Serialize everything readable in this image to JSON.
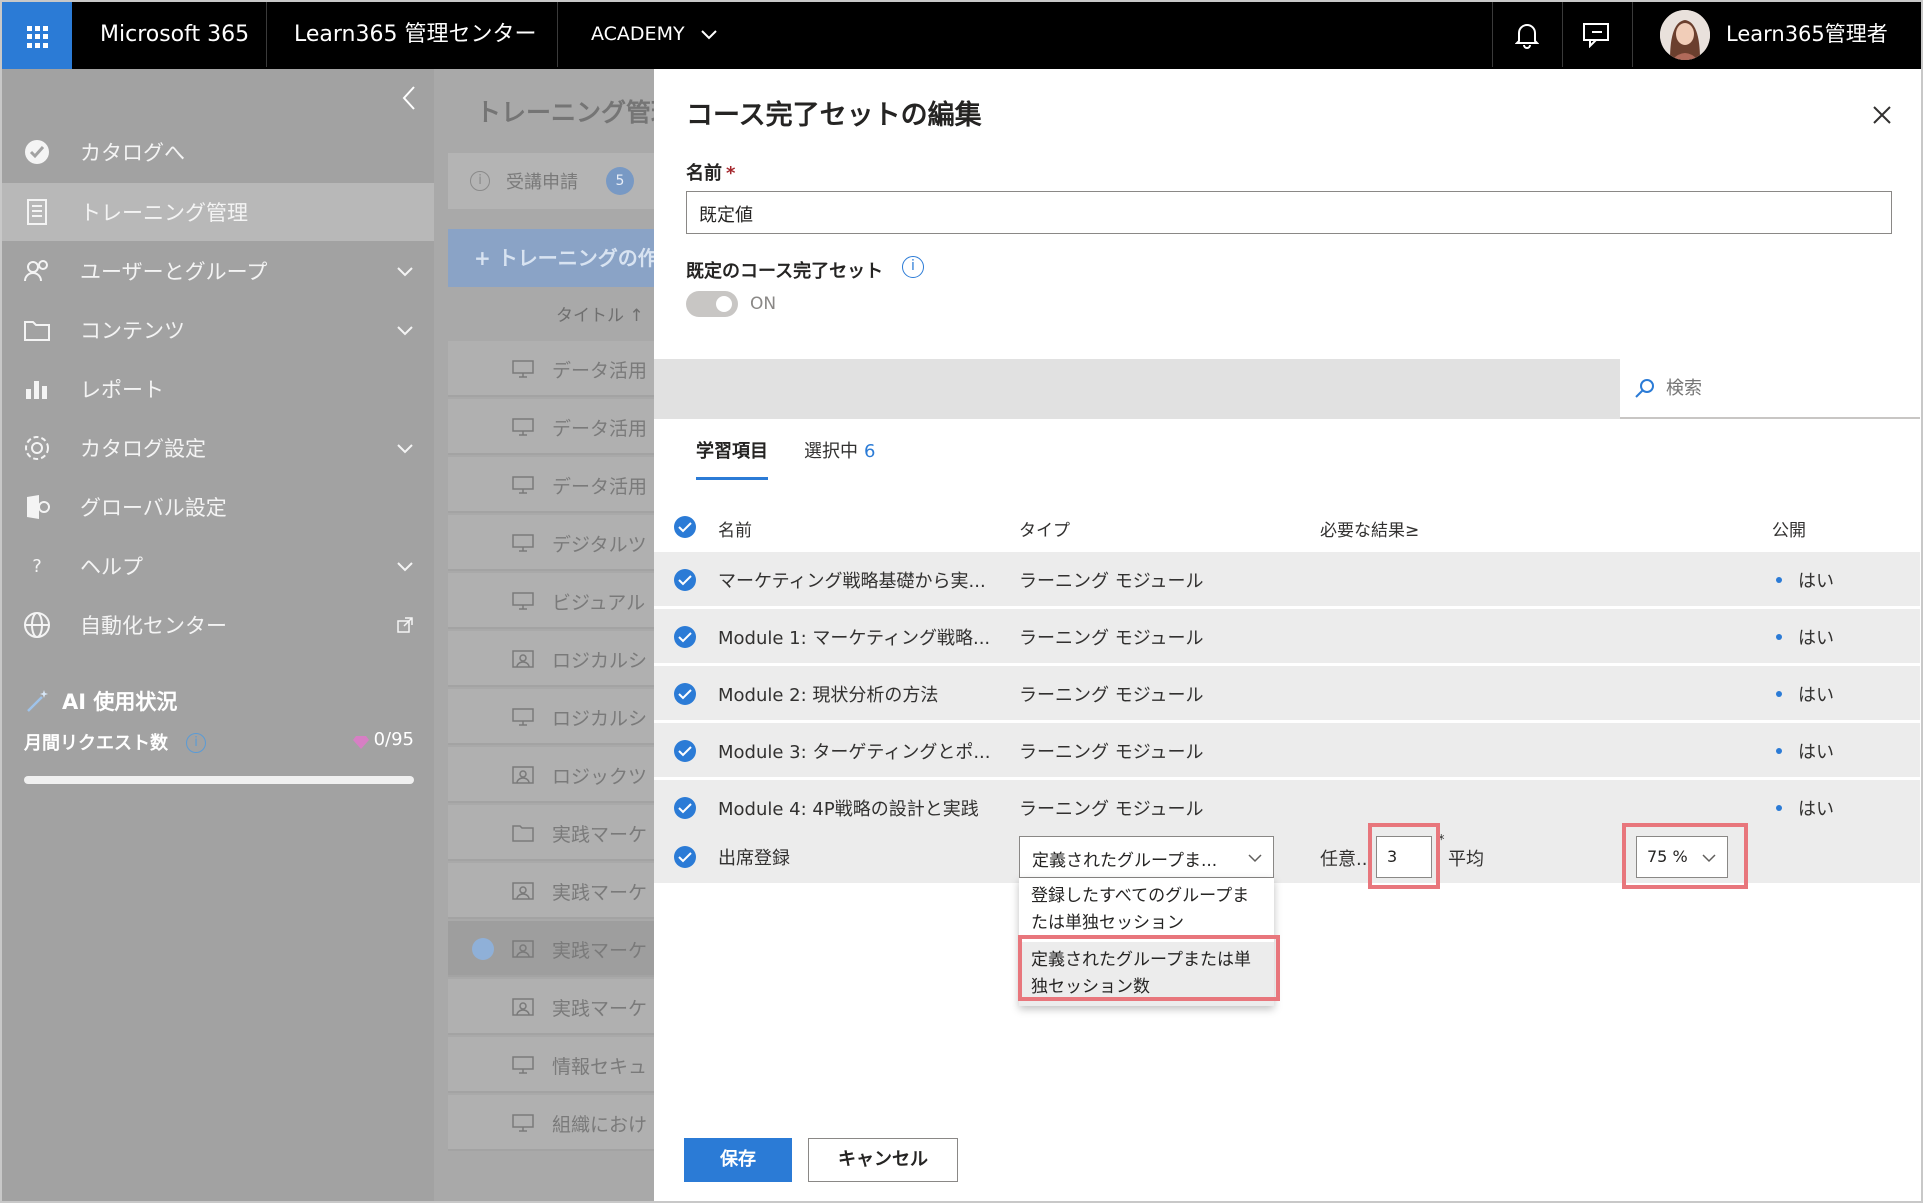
{
  "topbar": {
    "brand": "Microsoft 365",
    "app": "Learn365 管理センター",
    "tenant": "ACADEMY",
    "user": "Learn365管理者"
  },
  "nav": {
    "items": [
      {
        "label": "カタログへ",
        "icon": "check-circle-icon"
      },
      {
        "label": "トレーニング管理",
        "icon": "document-icon",
        "active": true
      },
      {
        "label": "ユーザーとグループ",
        "icon": "people-icon"
      },
      {
        "label": "コンテンツ",
        "icon": "folder-icon"
      },
      {
        "label": "レポート",
        "icon": "bar-chart-icon"
      },
      {
        "label": "カタログ設定",
        "icon": "gear-icon"
      },
      {
        "label": "グローバル設定",
        "icon": "settings-app-icon"
      },
      {
        "label": "ヘルプ",
        "icon": "question-icon"
      },
      {
        "label": "自動化センター",
        "icon": "globe-icon"
      }
    ],
    "ai_title": "AI 使用状況",
    "monthly_requests_label": "月間リクエスト数",
    "monthly_requests_count": "0/95",
    "monthly_requests_fraction": 0.0
  },
  "background_page": {
    "title": "トレーニング管理",
    "tab_label": "受講申請",
    "tab_badge": "5",
    "create_button": "+ トレーニングの作成",
    "column_title": "タイトル ↑",
    "rows": [
      {
        "text": "データ活用",
        "icon": "monitor-icon"
      },
      {
        "text": "データ活用",
        "icon": "monitor-icon"
      },
      {
        "text": "データ活用",
        "icon": "monitor-icon"
      },
      {
        "text": "デジタルツ",
        "icon": "monitor-icon"
      },
      {
        "text": "ビジュアル",
        "icon": "monitor-icon"
      },
      {
        "text": "ロジカルシ",
        "icon": "classroom-icon"
      },
      {
        "text": "ロジカルシ",
        "icon": "monitor-icon"
      },
      {
        "text": "ロジックツ",
        "icon": "classroom-icon"
      },
      {
        "text": "実践マーケ",
        "icon": "folder-icon"
      },
      {
        "text": "実践マーケ",
        "icon": "classroom-icon"
      },
      {
        "text": "実践マーケ",
        "icon": "classroom-icon",
        "selected": true
      },
      {
        "text": "実践マーケ",
        "icon": "classroom-icon"
      },
      {
        "text": "情報セキュ",
        "icon": "monitor-icon"
      },
      {
        "text": "組織におけ",
        "icon": "monitor-icon"
      }
    ]
  },
  "panel": {
    "title": "コース完了セットの編集",
    "name_label": "名前",
    "name_value": "既定値",
    "default_label": "既定のコース完了セット",
    "toggle_state": "ON",
    "search_placeholder": "検索",
    "tabs": [
      {
        "label": "学習項目",
        "active": true
      },
      {
        "label": "選択中",
        "count": "6"
      }
    ],
    "columns": {
      "name": "名前",
      "type": "タイプ",
      "required": "必要な結果≥",
      "published": "公開"
    },
    "rows": [
      {
        "name": "マーケティング戦略基礎から実...",
        "type": "ラーニング モジュール",
        "published": "はい"
      },
      {
        "name": "Module 1: マーケティング戦略...",
        "type": "ラーニング モジュール",
        "published": "はい"
      },
      {
        "name": "Module 2: 現状分析の方法",
        "type": "ラーニング モジュール",
        "published": "はい"
      },
      {
        "name": "Module 3: ターゲティングとポ...",
        "type": "ラーニング モジュール",
        "published": "はい"
      },
      {
        "name": "Module 4: 4P戦略の設計と実践",
        "type": "ラーニング モジュール",
        "published": "はい"
      }
    ],
    "attendance_row": {
      "name": "出席登録",
      "type_selected": "定義されたグループま...",
      "type_options": [
        "登録したすべてのグループまたは単独セッション",
        "定義されたグループまたは単独セッション数"
      ],
      "optional_label": "任意...",
      "count_value": "3",
      "average_label": "平均",
      "percent_value": "75 %"
    },
    "save_label": "保存",
    "cancel_label": "キャンセル"
  }
}
